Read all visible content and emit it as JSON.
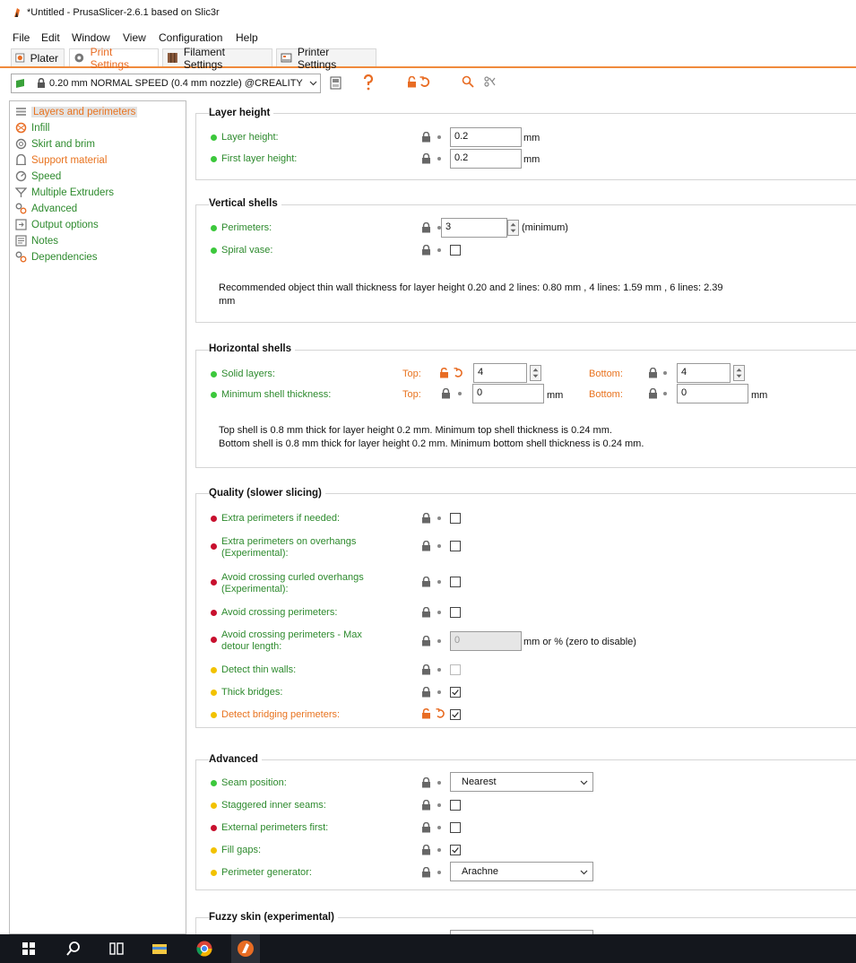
{
  "window": {
    "title": "*Untitled - PrusaSlicer-2.6.1 based on Slic3r"
  },
  "menu": [
    "File",
    "Edit",
    "Window",
    "View",
    "Configuration",
    "Help"
  ],
  "tabs": [
    "Plater",
    "Print Settings",
    "Filament Settings",
    "Printer Settings"
  ],
  "preset": {
    "value": "0.20 mm NORMAL SPEED (0.4 mm nozzle) @CREALITY"
  },
  "sidebar": [
    "Layers and perimeters",
    "Infill",
    "Skirt and brim",
    "Support material",
    "Speed",
    "Multiple Extruders",
    "Advanced",
    "Output options",
    "Notes",
    "Dependencies"
  ],
  "layer_height": {
    "title": "Layer height",
    "layer_height_label": "Layer height:",
    "layer_height_value": "0.2",
    "first_layer_label": "First layer height:",
    "first_layer_value": "0.2",
    "unit": "mm"
  },
  "vertical_shells": {
    "title": "Vertical shells",
    "perimeters_label": "Perimeters:",
    "perimeters_value": "3",
    "perimeters_suffix": "(minimum)",
    "spiral_label": "Spiral vase:",
    "note_line1": "Recommended object thin wall thickness for layer height 0.20 and 2 lines: 0.80 mm , 4 lines: 1.59 mm , 6 lines: 2.39",
    "note_line2": "mm"
  },
  "horizontal_shells": {
    "title": "Horizontal shells",
    "solid_label": "Solid layers:",
    "top_label": "Top:",
    "bottom_label": "Bottom:",
    "solid_top": "4",
    "solid_bottom": "4",
    "min_label": "Minimum shell thickness:",
    "min_top": "0",
    "min_bottom": "0",
    "unit": "mm",
    "note_line1": "Top shell is 0.8 mm thick for layer height 0.2 mm. Minimum top shell thickness is 0.24 mm.",
    "note_line2": "Bottom shell is 0.8 mm thick for layer height 0.2 mm. Minimum bottom shell thickness is 0.24 mm."
  },
  "quality": {
    "title": "Quality (slower slicing)",
    "extra_perimeters": "Extra perimeters if needed:",
    "extra_overhangs_1": "Extra perimeters on overhangs",
    "extra_overhangs_2": "(Experimental):",
    "avoid_curled_1": "Avoid crossing curled overhangs",
    "avoid_curled_2": "(Experimental):",
    "avoid_crossing": "Avoid crossing perimeters:",
    "max_detour_1": "Avoid crossing perimeters - Max",
    "max_detour_2": "detour length:",
    "max_detour_value": "0",
    "max_detour_unit": "mm or % (zero to disable)",
    "thin_walls": "Detect thin walls:",
    "thick_bridges": "Thick bridges:",
    "bridging_perims": "Detect bridging perimeters:"
  },
  "advanced": {
    "title": "Advanced",
    "seam_label": "Seam position:",
    "seam_value": "Nearest",
    "staggered_label": "Staggered inner seams:",
    "ext_first_label": "External perimeters first:",
    "fill_gaps_label": "Fill gaps:",
    "generator_label": "Perimeter generator:",
    "generator_value": "Arachne"
  },
  "fuzzy": {
    "title": "Fuzzy skin (experimental)"
  },
  "colors": {
    "accent": "#e8731f",
    "green": "#2d8a2d",
    "red": "#c8102e",
    "yellow": "#f2c200"
  }
}
